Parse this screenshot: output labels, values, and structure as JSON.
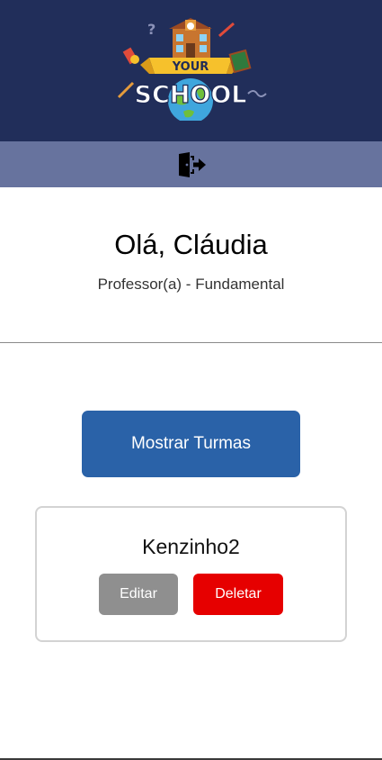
{
  "header": {
    "logo": {
      "top_word": "YOUR",
      "bottom_word": "SCHOOL"
    }
  },
  "toolbar": {
    "logout_icon": "logout-door-icon"
  },
  "profile": {
    "greeting": "Olá, Cláudia",
    "role": "Professor(a) - Fundamental"
  },
  "actions": {
    "show_classes_label": "Mostrar Turmas"
  },
  "class_card": {
    "name": "Kenzinho2",
    "edit_label": "Editar",
    "delete_label": "Deletar"
  },
  "colors": {
    "header_bg": "#212e5a",
    "toolbar_bg": "#67739e",
    "primary_button": "#2a62a8",
    "edit_button": "#8f8f8f",
    "delete_button": "#e60000"
  }
}
